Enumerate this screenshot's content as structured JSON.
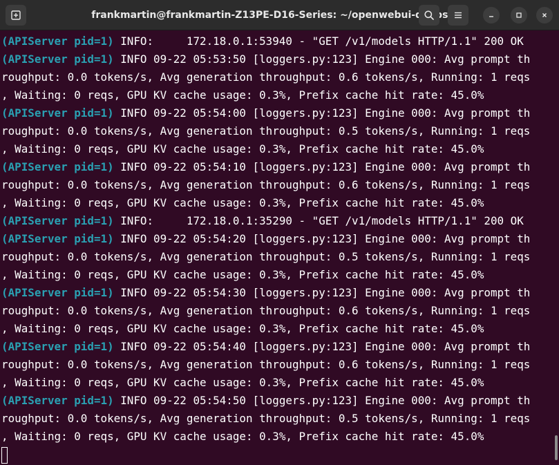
{
  "window": {
    "title": "frankmartin@frankmartin-Z13PE-D16-Series: ~/openwebui-deepseek",
    "icons": {
      "new_tab": "new-tab-icon",
      "search": "search-icon",
      "menu": "hamburger-menu-icon",
      "minimize": "minimize-icon",
      "maximize": "maximize-icon",
      "close": "close-icon"
    }
  },
  "colors": {
    "background": "#300a24",
    "titlebar": "#2c2c2c",
    "prefix": "#2aa1b3",
    "text": "#ffffff"
  },
  "terminal": {
    "lines": [
      {
        "prefix": "(APIServer pid=1)",
        "text": " INFO:     172.18.0.1:53940 - \"GET /v1/models HTTP/1.1\" 200 OK"
      },
      {
        "prefix": "(APIServer pid=1)",
        "text": " INFO 09-22 05:53:50 [loggers.py:123] Engine 000: Avg prompt th"
      },
      {
        "prefix": "",
        "text": "roughput: 0.0 tokens/s, Avg generation throughput: 0.6 tokens/s, Running: 1 reqs"
      },
      {
        "prefix": "",
        "text": ", Waiting: 0 reqs, GPU KV cache usage: 0.3%, Prefix cache hit rate: 45.0%"
      },
      {
        "prefix": "(APIServer pid=1)",
        "text": " INFO 09-22 05:54:00 [loggers.py:123] Engine 000: Avg prompt th"
      },
      {
        "prefix": "",
        "text": "roughput: 0.0 tokens/s, Avg generation throughput: 0.5 tokens/s, Running: 1 reqs"
      },
      {
        "prefix": "",
        "text": ", Waiting: 0 reqs, GPU KV cache usage: 0.3%, Prefix cache hit rate: 45.0%"
      },
      {
        "prefix": "(APIServer pid=1)",
        "text": " INFO 09-22 05:54:10 [loggers.py:123] Engine 000: Avg prompt th"
      },
      {
        "prefix": "",
        "text": "roughput: 0.0 tokens/s, Avg generation throughput: 0.6 tokens/s, Running: 1 reqs"
      },
      {
        "prefix": "",
        "text": ", Waiting: 0 reqs, GPU KV cache usage: 0.3%, Prefix cache hit rate: 45.0%"
      },
      {
        "prefix": "(APIServer pid=1)",
        "text": " INFO:     172.18.0.1:35290 - \"GET /v1/models HTTP/1.1\" 200 OK"
      },
      {
        "prefix": "(APIServer pid=1)",
        "text": " INFO 09-22 05:54:20 [loggers.py:123] Engine 000: Avg prompt th"
      },
      {
        "prefix": "",
        "text": "roughput: 0.0 tokens/s, Avg generation throughput: 0.5 tokens/s, Running: 1 reqs"
      },
      {
        "prefix": "",
        "text": ", Waiting: 0 reqs, GPU KV cache usage: 0.3%, Prefix cache hit rate: 45.0%"
      },
      {
        "prefix": "(APIServer pid=1)",
        "text": " INFO 09-22 05:54:30 [loggers.py:123] Engine 000: Avg prompt th"
      },
      {
        "prefix": "",
        "text": "roughput: 0.0 tokens/s, Avg generation throughput: 0.6 tokens/s, Running: 1 reqs"
      },
      {
        "prefix": "",
        "text": ", Waiting: 0 reqs, GPU KV cache usage: 0.3%, Prefix cache hit rate: 45.0%"
      },
      {
        "prefix": "(APIServer pid=1)",
        "text": " INFO 09-22 05:54:40 [loggers.py:123] Engine 000: Avg prompt th"
      },
      {
        "prefix": "",
        "text": "roughput: 0.0 tokens/s, Avg generation throughput: 0.6 tokens/s, Running: 1 reqs"
      },
      {
        "prefix": "",
        "text": ", Waiting: 0 reqs, GPU KV cache usage: 0.3%, Prefix cache hit rate: 45.0%"
      },
      {
        "prefix": "(APIServer pid=1)",
        "text": " INFO 09-22 05:54:50 [loggers.py:123] Engine 000: Avg prompt th"
      },
      {
        "prefix": "",
        "text": "roughput: 0.0 tokens/s, Avg generation throughput: 0.5 tokens/s, Running: 1 reqs"
      },
      {
        "prefix": "",
        "text": ", Waiting: 0 reqs, GPU KV cache usage: 0.3%, Prefix cache hit rate: 45.0%"
      }
    ]
  }
}
